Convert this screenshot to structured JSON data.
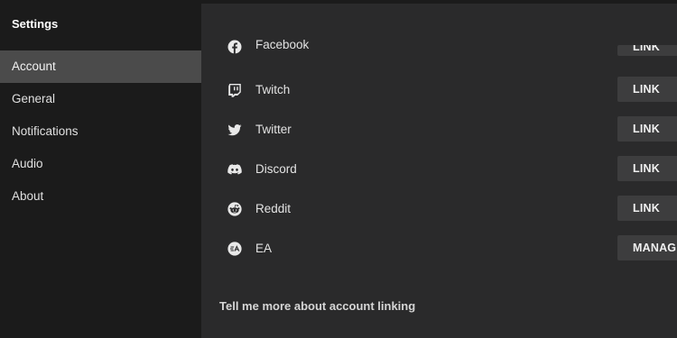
{
  "sidebar": {
    "title": "Settings",
    "items": [
      {
        "label": "Account",
        "active": true
      },
      {
        "label": "General"
      },
      {
        "label": "Notifications"
      },
      {
        "label": "Audio"
      },
      {
        "label": "About"
      }
    ]
  },
  "accounts": [
    {
      "service": "Facebook",
      "icon": "facebook-icon",
      "action": "LINK"
    },
    {
      "service": "Twitch",
      "icon": "twitch-icon",
      "action": "LINK"
    },
    {
      "service": "Twitter",
      "icon": "twitter-icon",
      "action": "LINK"
    },
    {
      "service": "Discord",
      "icon": "discord-icon",
      "action": "LINK"
    },
    {
      "service": "Reddit",
      "icon": "reddit-icon",
      "action": "LINK"
    },
    {
      "service": "EA",
      "icon": "ea-icon",
      "action": "MANAGE"
    }
  ],
  "footer": {
    "more_link": "Tell me more about account linking"
  },
  "colors": {
    "sidebar_bg": "#1b1b1b",
    "active_item_bg": "#4b4b4b",
    "main_bg": "#2a2a2b",
    "button_bg": "#3d3d3e"
  }
}
